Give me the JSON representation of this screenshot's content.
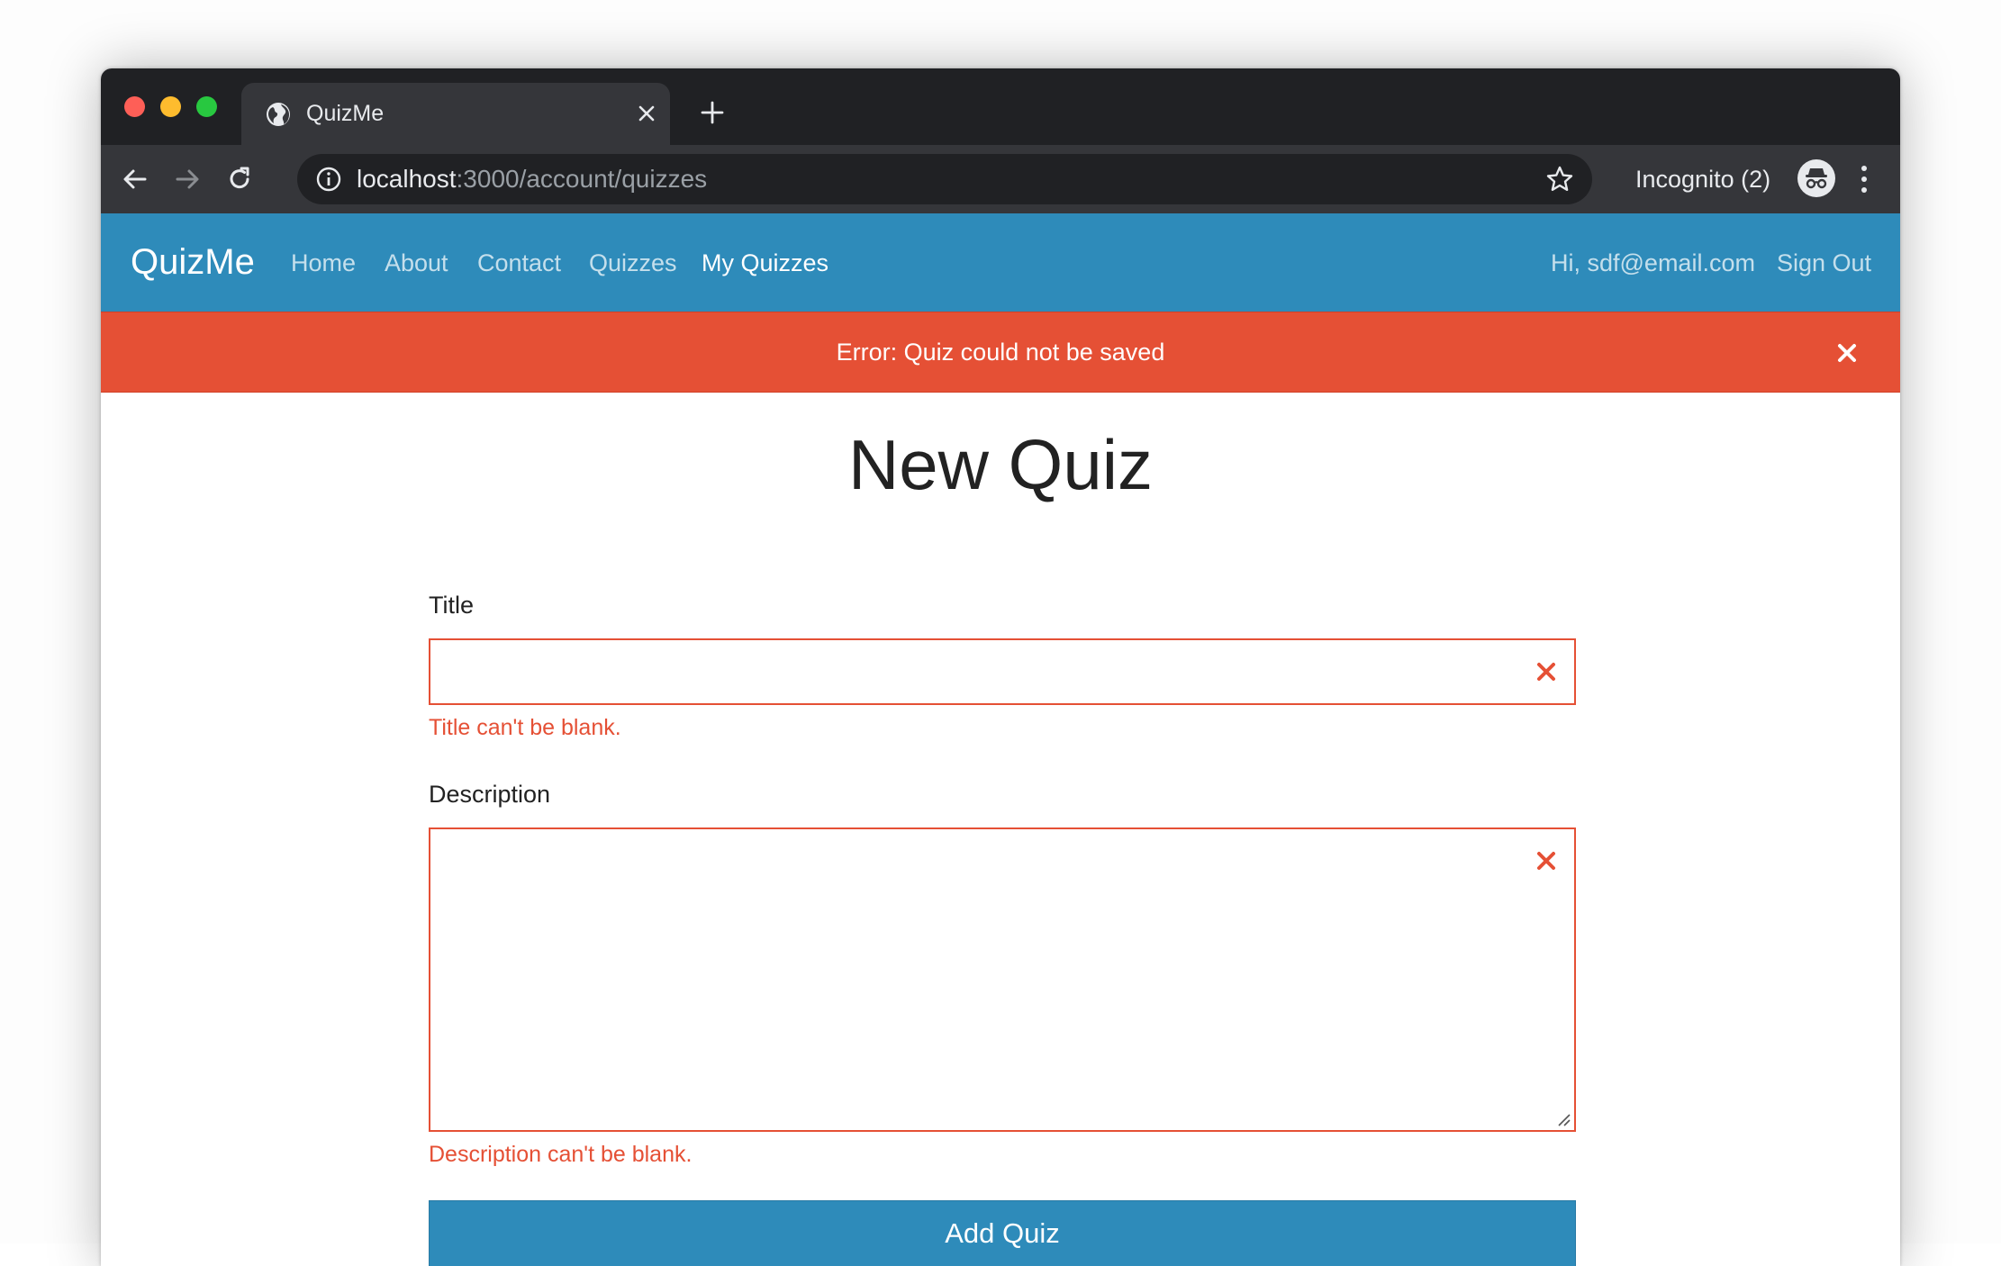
{
  "browser": {
    "tab": {
      "title": "QuizMe",
      "favicon": "globe-icon"
    },
    "address_bar": {
      "host": "localhost",
      "path": ":3000/account/quizzes"
    },
    "profile": {
      "label": "Incognito (2)",
      "icon": "incognito-icon"
    },
    "colors": {
      "tab_strip": "#202124",
      "toolbar": "#35363a"
    }
  },
  "navbar": {
    "brand": "QuizMe",
    "links": [
      {
        "label": "Home"
      },
      {
        "label": "About"
      },
      {
        "label": "Contact"
      },
      {
        "label": "Quizzes"
      },
      {
        "label": "My Quizzes",
        "active": true
      }
    ],
    "greeting": "Hi, sdf@email.com",
    "sign_out": "Sign Out",
    "color": "#2e8bba"
  },
  "alert": {
    "message": "Error: Quiz could not be saved",
    "color": "#e55035"
  },
  "form": {
    "heading": "New Quiz",
    "title_field": {
      "label": "Title",
      "value": "",
      "error": "Title can't be blank."
    },
    "description_field": {
      "label": "Description",
      "value": "",
      "error": "Description can't be blank."
    },
    "submit_label": "Add Quiz"
  }
}
